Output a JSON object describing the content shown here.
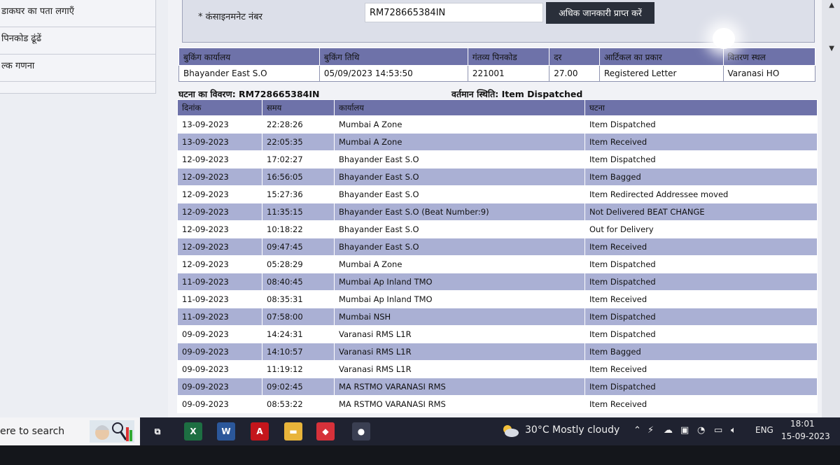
{
  "nav": {
    "items": [
      "डाकघर का पता लगाएँ",
      "पिनकोड ढूंढें",
      "ल्क गणना"
    ]
  },
  "search": {
    "label": "* कंसाइनमनेट नंबर",
    "value": "RM728665384IN",
    "button_label": "अधिक जानकारी प्राप्त करें"
  },
  "booking": {
    "headers": [
      "बुकिंग कार्यालय",
      "बुकिंग तिथि",
      "गंतव्य पिनकोड",
      "दर",
      "आर्टिकल का प्रकार",
      "वितरण स्थल"
    ],
    "row": [
      "Bhayander East S.O",
      "05/09/2023 14:53:50",
      "221001",
      "27.00",
      "Registered Letter",
      "Varanasi HO"
    ]
  },
  "events": {
    "title": "घटना का विवरण: RM728665384IN",
    "status": "वर्तमान स्थिति: Item Dispatched",
    "headers": [
      "दिनांक",
      "समय",
      "कार्यालय",
      "घटना"
    ],
    "rows": [
      [
        "13-09-2023",
        "22:28:26",
        "Mumbai A Zone",
        "Item Dispatched"
      ],
      [
        "13-09-2023",
        "22:05:35",
        "Mumbai A Zone",
        "Item Received"
      ],
      [
        "12-09-2023",
        "17:02:27",
        "Bhayander East S.O",
        "Item Dispatched"
      ],
      [
        "12-09-2023",
        "16:56:05",
        "Bhayander East S.O",
        "Item Bagged"
      ],
      [
        "12-09-2023",
        "15:27:36",
        "Bhayander East S.O",
        "Item Redirected Addressee moved"
      ],
      [
        "12-09-2023",
        "11:35:15",
        "Bhayander East S.O (Beat Number:9)",
        "Not Delivered BEAT CHANGE"
      ],
      [
        "12-09-2023",
        "10:18:22",
        "Bhayander East S.O",
        "Out for Delivery"
      ],
      [
        "12-09-2023",
        "09:47:45",
        "Bhayander East S.O",
        "Item Received"
      ],
      [
        "12-09-2023",
        "05:28:29",
        "Mumbai A Zone",
        "Item Dispatched"
      ],
      [
        "11-09-2023",
        "08:40:45",
        "Mumbai Ap Inland TMO",
        "Item Dispatched"
      ],
      [
        "11-09-2023",
        "08:35:31",
        "Mumbai Ap Inland TMO",
        "Item Received"
      ],
      [
        "11-09-2023",
        "07:58:00",
        "Mumbai NSH",
        "Item Dispatched"
      ],
      [
        "09-09-2023",
        "14:24:31",
        "Varanasi RMS L1R",
        "Item Dispatched"
      ],
      [
        "09-09-2023",
        "14:10:57",
        "Varanasi RMS L1R",
        "Item Bagged"
      ],
      [
        "09-09-2023",
        "11:19:12",
        "Varanasi RMS L1R",
        "Item Received"
      ],
      [
        "09-09-2023",
        "09:02:45",
        "MA RSTMO VARANASI RMS",
        "Item Dispatched"
      ],
      [
        "09-09-2023",
        "08:53:22",
        "MA RSTMO VARANASI RMS",
        "Item Received"
      ]
    ]
  },
  "taskbar": {
    "search_text": "ere to search",
    "apps": [
      {
        "icon": "task-view-icon",
        "glyph": "⧉",
        "color": "#1f2230"
      },
      {
        "icon": "excel-icon",
        "glyph": "X",
        "color": "#1d6f42"
      },
      {
        "icon": "word-icon",
        "glyph": "W",
        "color": "#2b579a"
      },
      {
        "icon": "acrobat-icon",
        "glyph": "A",
        "color": "#c4161c"
      },
      {
        "icon": "file-explorer-icon",
        "glyph": "▬",
        "color": "#e8b43a"
      },
      {
        "icon": "anydesk-icon",
        "glyph": "◆",
        "color": "#d6313a"
      },
      {
        "icon": "chrome-icon",
        "glyph": "●",
        "color": "#3a3f52"
      }
    ],
    "weather": "30°C  Mostly cloudy",
    "language": "ENG",
    "time": "18:01",
    "date": "15-09-2023"
  },
  "colors": {
    "header_row": "#6e72a9",
    "alt_row": "#aab0d4",
    "button": "#2a2f3a",
    "taskbar": "#1f2230"
  }
}
